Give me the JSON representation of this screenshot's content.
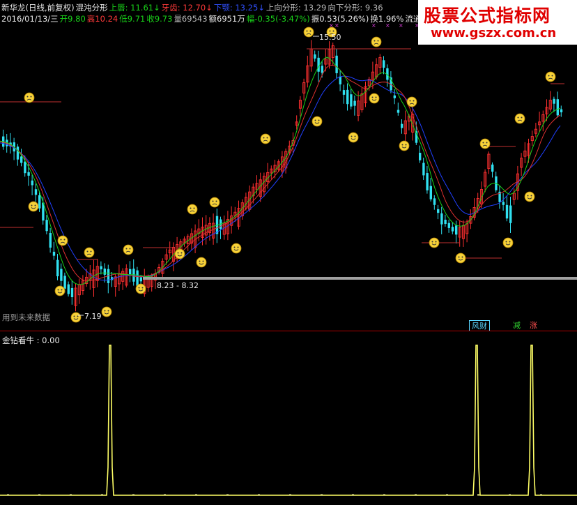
{
  "header": {
    "line1": [
      {
        "text": "新华龙(日线,前复权)",
        "color": "white"
      },
      {
        "text": "混沌分形",
        "color": "white"
      },
      {
        "text": "上唇: 11.61↓",
        "color": "green"
      },
      {
        "text": "牙齿: 12.70↓",
        "color": "red"
      },
      {
        "text": "下颚: 13.25↓",
        "color": "blue"
      },
      {
        "text": "上向分形: 13.29",
        "color": "gray"
      },
      {
        "text": "向下分形: 9.36",
        "color": "gray"
      }
    ],
    "line2": [
      {
        "text": "2016/01/13/三",
        "color": "white"
      },
      {
        "text": "开9.80",
        "color": "green"
      },
      {
        "text": "高10.24",
        "color": "red"
      },
      {
        "text": "低9.71",
        "color": "green"
      },
      {
        "text": "收9.73",
        "color": "green"
      },
      {
        "text": "量69543",
        "color": "gray"
      },
      {
        "text": "额6951万",
        "color": "white"
      },
      {
        "text": "幅-0.35(-3.47%)",
        "color": "green"
      },
      {
        "text": "振0.53(5.26%)",
        "color": "white"
      },
      {
        "text": "换1.96%",
        "color": "white"
      },
      {
        "text": "流通3",
        "color": "white"
      }
    ]
  },
  "watermark": {
    "title": "股票公式指标网",
    "url": "www.gszx.com.cn"
  },
  "annotations": {
    "high_price": "15.50",
    "low_price": "7.19",
    "range": "8.23 - 8.32",
    "future_data": "用到未来数据"
  },
  "buttons": {
    "fu": "风财",
    "jian": "减",
    "zhang": "涨"
  },
  "indicator": {
    "label": "金钻看牛 : 0.00",
    "color": "#ffff66",
    "spikes": [
      158,
      684,
      763
    ]
  },
  "colors": {
    "up": "#ff3030",
    "down": "#30e0f0",
    "lip": "#19d219",
    "teeth": "#e03030",
    "jaw": "#2040ff",
    "fractal_up_icon": "sad-face-icon",
    "fractal_down_icon": "smile-face-icon"
  }
}
